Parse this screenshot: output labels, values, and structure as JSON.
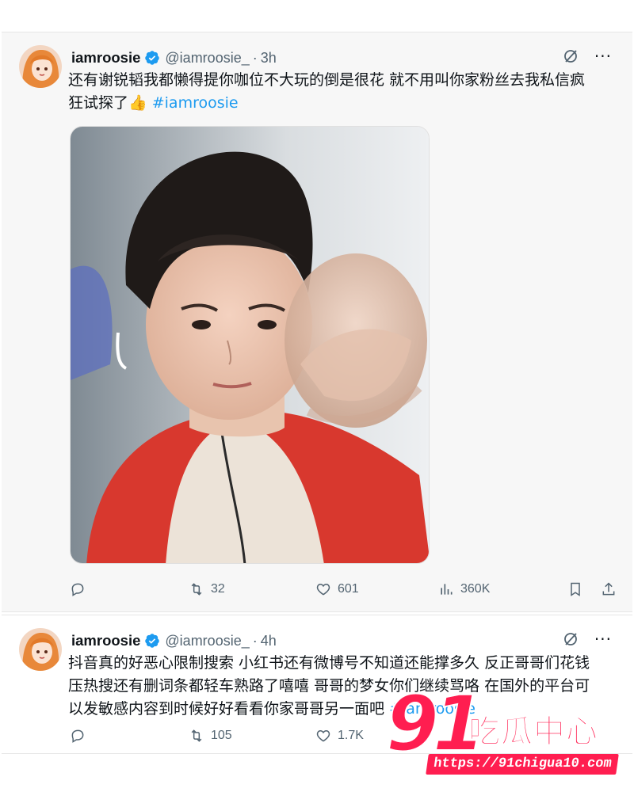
{
  "tweets": [
    {
      "name": "iamroosie",
      "handle": "@iamroosie_",
      "dot": "·",
      "time": "3h",
      "text_line1": "还有谢锐韬我都懒得提你咖位不大玩的倒是很花 就不用叫你家粉丝去我私信疯",
      "text_line2_start": "狂试探了",
      "emoji": "👍",
      "hashtag": "#iamroosie",
      "media_icon": "selfie-photo",
      "stats": {
        "replies": "",
        "retweets": "32",
        "likes": "601",
        "views": "360K"
      }
    },
    {
      "name": "iamroosie",
      "handle": "@iamroosie_",
      "dot": "·",
      "time": "4h",
      "text_line1": "抖音真的好恶心限制搜索 小红书还有微博号不知道还能撑多久 反正哥哥们花钱",
      "text_line2": "压热搜还有删词条都轻车熟路了嘻嘻 哥哥的梦女你们继续骂咯 在国外的平台可",
      "text_line3_start": "以发敏感内容到时候好好看看你家哥哥另一面吧",
      "hashtag": "#iamroosie",
      "stats": {
        "replies": "",
        "retweets": "105",
        "likes": "1.7K",
        "views": ""
      }
    }
  ],
  "watermark": {
    "number": "91",
    "title": "吃瓜中心",
    "url": "https://91chigua10.com"
  },
  "icons": {
    "verified": "verified-badge-icon",
    "grok": "grok-icon",
    "more": "more-icon",
    "reply": "reply-icon",
    "retweet": "retweet-icon",
    "like": "like-icon",
    "views": "views-icon",
    "bookmark": "bookmark-icon",
    "share": "share-icon"
  },
  "colors": {
    "accent": "#1d9bf0",
    "muted": "#536471",
    "watermark": "#ff1e50"
  }
}
